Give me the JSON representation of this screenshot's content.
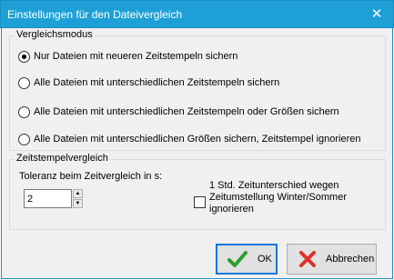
{
  "window": {
    "title": "Einstellungen für den Dateivergleich"
  },
  "compare_mode": {
    "legend": "Vergleichsmodus",
    "options": [
      {
        "label": "Nur Dateien mit neueren Zeitstempeln sichern",
        "checked": true
      },
      {
        "label": "Alle Dateien mit unterschiedlichen Zeitstempeln sichern",
        "checked": false
      },
      {
        "label": "Alle Dateien mit unterschiedlichen Zeitstempeln oder Größen sichern",
        "checked": false
      },
      {
        "label": "Alle Dateien mit unterschiedlichen Größen sichern, Zeitstempel ignorieren",
        "checked": false
      }
    ]
  },
  "timestamp": {
    "legend": "Zeitstempelvergleich",
    "tolerance_label": "Toleranz beim Zeitvergleich in s:",
    "tolerance_value": "2",
    "dst_checkbox_label": "1 Std. Zeitunterschied wegen Zeitumstellung Winter/Sommer ignorieren",
    "dst_checked": false
  },
  "buttons": {
    "ok": "OK",
    "cancel": "Abbrechen"
  },
  "colors": {
    "titlebar": "#1ea0d6",
    "ok_icon": "#2e9e2e",
    "cancel_icon": "#e0302b",
    "default_border": "#0078d7"
  }
}
